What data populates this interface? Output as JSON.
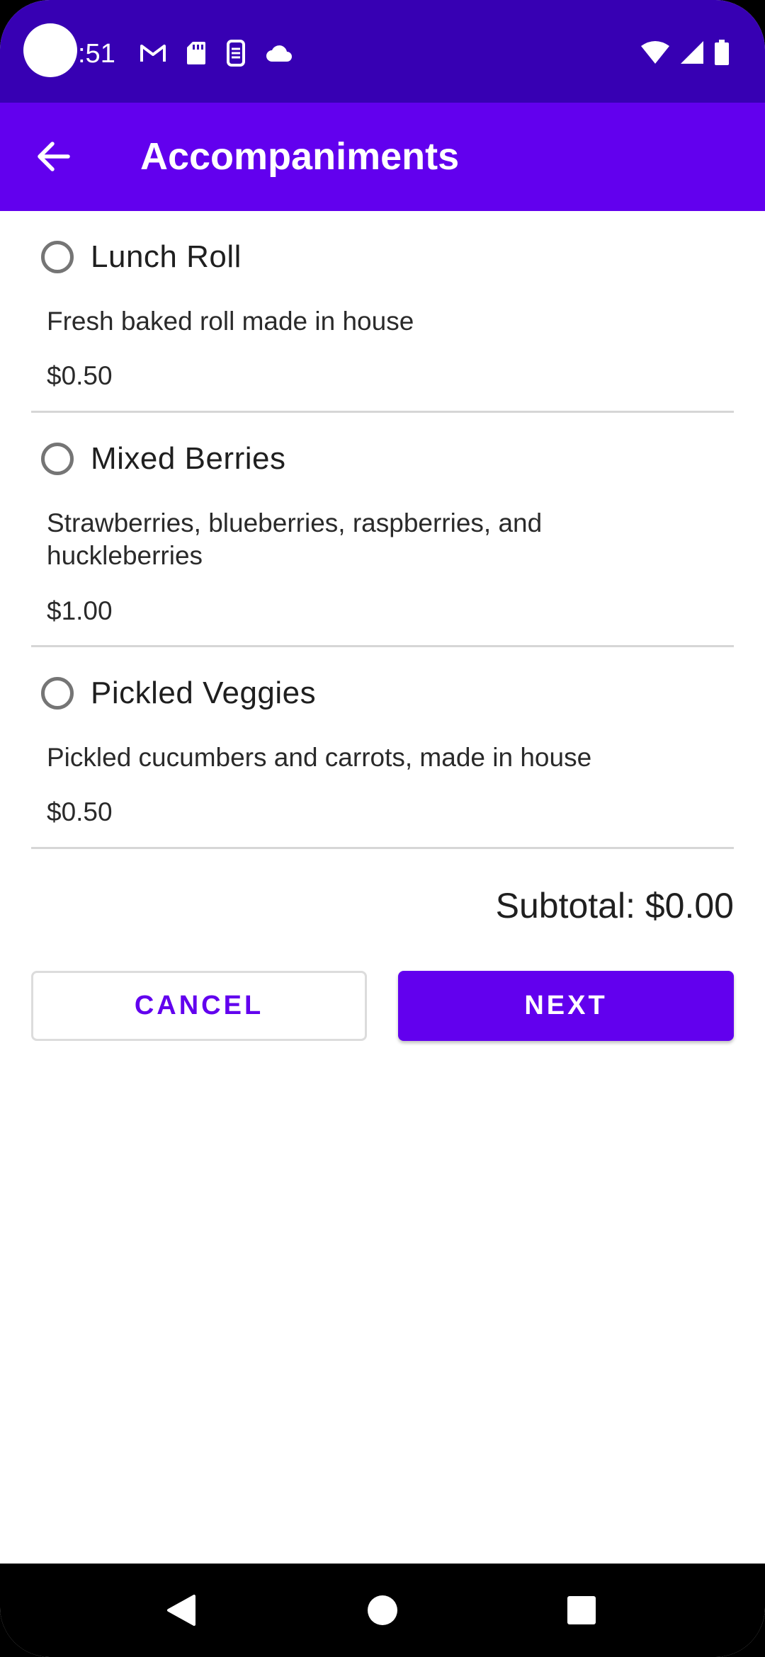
{
  "status_bar": {
    "time": ":51",
    "icons_left": [
      "gmail-icon",
      "sd-card-icon",
      "nfc-icon",
      "cloud-icon"
    ],
    "icons_right": [
      "wifi-icon",
      "signal-icon",
      "battery-icon"
    ]
  },
  "app_bar": {
    "title": "Accompaniments",
    "back_icon": "arrow-back-icon"
  },
  "items": [
    {
      "name": "Lunch Roll",
      "description": "Fresh baked roll made in house",
      "price": "$0.50",
      "selected": false
    },
    {
      "name": "Mixed Berries",
      "description": "Strawberries, blueberries, raspberries, and huckleberries",
      "price": "$1.00",
      "selected": false
    },
    {
      "name": "Pickled Veggies",
      "description": "Pickled cucumbers and carrots, made in house",
      "price": "$0.50",
      "selected": false
    }
  ],
  "subtotal": "Subtotal: $0.00",
  "buttons": {
    "cancel_label": "CANCEL",
    "next_label": "NEXT"
  },
  "nav_bar": {
    "icons": [
      "back-triangle-icon",
      "home-circle-icon",
      "recents-square-icon"
    ]
  },
  "colors": {
    "status_bar": "#3700b3",
    "app_bar": "#6200ee",
    "accent": "#6200ee"
  }
}
